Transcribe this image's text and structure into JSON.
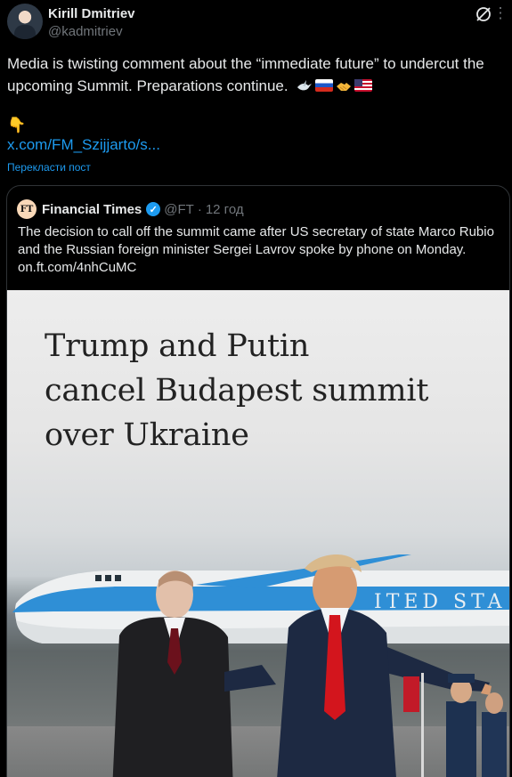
{
  "tweet": {
    "author_name": "Kirill Dmitriev",
    "author_handle": "@kadmitriev",
    "text": "Media is twisting comment about the “immediate future” to undercut the upcoming Summit. Preparations continue.",
    "pointer_emoji": "👇",
    "link": "x.com/FM_Szijjarto/s...",
    "translate_label": "Перекласти пост",
    "emojis": [
      "dove-emoji",
      "russia-flag-emoji",
      "handshake-emoji",
      "usa-flag-emoji"
    ]
  },
  "quoted": {
    "author_name": "Financial Times",
    "logo_text": "FT",
    "handle": "@FT",
    "separator": "·",
    "time": "12 год",
    "text": "The decision to call off the summit came after US secretary of state Marco Rubio and the Russian foreign minister Sergei Lavrov spoke by phone on Monday. on.ft.com/4nhCuMC",
    "image": {
      "headline_line1": "Trump and Putin",
      "headline_line2": "cancel Budapest summit",
      "headline_line3": "over Ukraine",
      "plane_text": "ITED STA"
    }
  },
  "colors": {
    "background": "#000000",
    "link": "#1d9bf0",
    "muted": "#71767b",
    "border": "#2f3336",
    "verified": "#1d9bf0"
  }
}
